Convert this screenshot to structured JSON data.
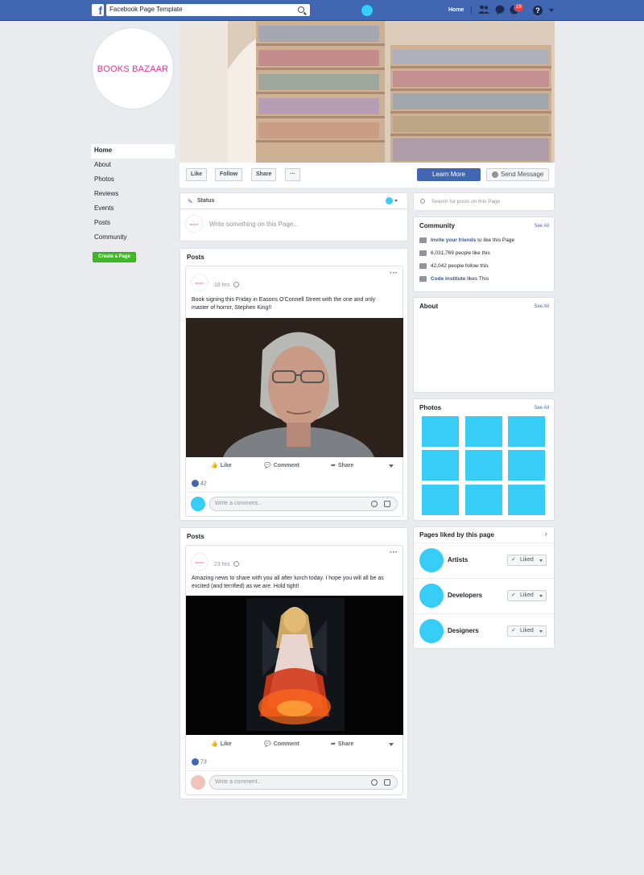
{
  "topbar": {
    "logo": "f",
    "search_text": "Facebook Page Template",
    "home": "Home",
    "notifications_count": "19",
    "help": "?"
  },
  "page": {
    "name": "BOOKS BAZAAR",
    "nav": [
      "Home",
      "About",
      "Photos",
      "Reviews",
      "Events",
      "Posts",
      "Community"
    ],
    "create_page": "Create a Page"
  },
  "actions": {
    "like": "Like",
    "follow": "Follow",
    "share": "Share",
    "more": "···",
    "learn_more": "Learn More",
    "send_message": "Send Message"
  },
  "status": {
    "label": "Status",
    "placeholder": "Write something on this Page..."
  },
  "posts": [
    {
      "header": "Posts",
      "time": "18 hrs",
      "text": "Book signing this Friday in Easons O'Connell Street with the one and only master of horror, Stephen King!!",
      "likes": "42",
      "comment_placeholder": "Write a comment..",
      "like_label": "Like",
      "comment_label": "Comment",
      "share_label": "Share"
    },
    {
      "header": "Posts",
      "time": "23 hrs",
      "text": "Amazing news to share with you all after lunch today. I hope you will all be as excited (and terrified) as we are. Hold tight!",
      "likes": "73",
      "comment_placeholder": "Write a comment..",
      "like_label": "Like",
      "comment_label": "Comment",
      "share_label": "Share"
    }
  ],
  "sidebar": {
    "search_placeholder": "Search for posts on this Page",
    "community": {
      "title": "Community",
      "see_all": "See All",
      "invite_link": "Invite your friends",
      "invite_rest": "to like this Page",
      "likes": "6,031,769 people like this",
      "follows": "42,042 people follow this",
      "ci_link": "Code Institute",
      "ci_rest": "likes This"
    },
    "about": {
      "title": "About",
      "see_all": "See All"
    },
    "photos": {
      "title": "Photos",
      "see_all": "See All"
    },
    "pages_liked": {
      "title": "Pages liked by this page",
      "items": [
        {
          "name": "Artists",
          "button": "Liked"
        },
        {
          "name": "Developers",
          "button": "Liked"
        },
        {
          "name": "Designers",
          "button": "Liked"
        }
      ]
    }
  },
  "colors": {
    "brand": "#4267b2",
    "accent": "#37cdf7",
    "create": "#42b72a",
    "pink": "#e0368f"
  }
}
